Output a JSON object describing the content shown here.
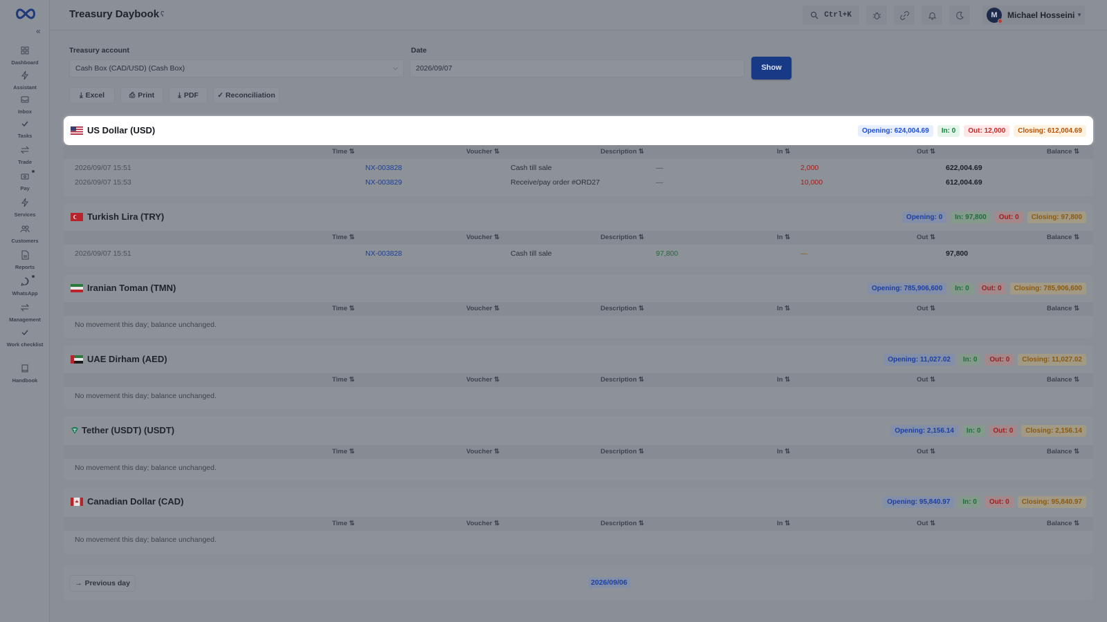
{
  "sidebar": {
    "items": [
      {
        "label": "Dashboard",
        "icon": "dashboard-icon"
      },
      {
        "label": "Assistant",
        "icon": "assistant-icon"
      },
      {
        "label": "Inbox",
        "icon": "inbox-icon"
      },
      {
        "label": "Tasks",
        "icon": "tasks-icon"
      },
      {
        "label": "Trade",
        "icon": "trade-icon"
      },
      {
        "label": "Pay",
        "icon": "pay-icon"
      },
      {
        "label": "Services",
        "icon": "services-icon"
      },
      {
        "label": "Customers",
        "icon": "customers-icon"
      },
      {
        "label": "Reports",
        "icon": "reports-icon"
      },
      {
        "label": "WhatsApp",
        "icon": "whatsapp-icon"
      },
      {
        "label": "Management",
        "icon": "management-icon"
      },
      {
        "label": "Work checklist",
        "icon": "checklist-icon"
      },
      {
        "label": "Handbook",
        "icon": "handbook-icon"
      }
    ]
  },
  "header": {
    "title": "Treasury Daybook",
    "search_shortcut": "Ctrl+K",
    "user": {
      "initial": "M",
      "name": "Michael Hosseini"
    }
  },
  "filters": {
    "account_label": "Treasury account",
    "account_value": "Cash Box (CAD/USD) (Cash Box)",
    "date_label": "Date",
    "date_value": "2026/09/07",
    "show_label": "Show"
  },
  "toolbar": {
    "excel": "Excel",
    "print": "Print",
    "pdf": "PDF",
    "reconciliation": "✓ Reconciliation"
  },
  "columns": {
    "time": "Time ⇅",
    "voucher": "Voucher ⇅",
    "description": "Description ⇅",
    "in": "In ⇅",
    "out": "Out ⇅",
    "balance": "Balance ⇅"
  },
  "sections": [
    {
      "title": "US Dollar (USD)",
      "opening": "Opening: 624,004.69",
      "in": "In: 0",
      "out": "Out: 12,000",
      "closing": "Closing: 612,004.69",
      "rows": [
        {
          "time": "2026/09/07 15:51",
          "voucher": "NX-003828",
          "description": "Cash till sale",
          "in": "—",
          "out": "2,000",
          "balance": "622,004.69"
        },
        {
          "time": "2026/09/07 15:53",
          "voucher": "NX-003829",
          "description": "Receive/pay order #ORD27",
          "in": "—",
          "out": "10,000",
          "balance": "612,004.69"
        }
      ]
    },
    {
      "title": "Turkish Lira (TRY)",
      "opening": "Opening: 0",
      "in": "In: 97,800",
      "out": "Out: 0",
      "closing": "Closing: 97,800",
      "rows": [
        {
          "time": "2026/09/07 15:51",
          "voucher": "NX-003828",
          "description": "Cash till sale",
          "in": "97,800",
          "out": "—",
          "balance": "97,800"
        }
      ]
    },
    {
      "title": "Iranian Toman (TMN)",
      "opening": "Opening: 785,906,600",
      "in": "In: 0",
      "out": "Out: 0",
      "closing": "Closing: 785,906,600",
      "empty": "No movement this day; balance unchanged."
    },
    {
      "title": "UAE Dirham (AED)",
      "opening": "Opening: 11,027.02",
      "in": "In: 0",
      "out": "Out: 0",
      "closing": "Closing: 11,027.02",
      "empty": "No movement this day; balance unchanged."
    },
    {
      "title": "Tether (USDT) (USDT)",
      "opening": "Opening: 2,156.14",
      "in": "In: 0",
      "out": "Out: 0",
      "closing": "Closing: 2,156.14",
      "empty": "No movement this day; balance unchanged."
    },
    {
      "title": "Canadian Dollar (CAD)",
      "opening": "Opening: 95,840.97",
      "in": "In: 0",
      "out": "Out: 0",
      "closing": "Closing: 95,840.97",
      "empty": "No movement this day; balance unchanged."
    }
  ],
  "footer": {
    "prev_label": "Previous day",
    "prev_date": "2026/09/06"
  },
  "colors": {
    "accent": "#183a86",
    "opening": "#1d4ed8",
    "in": "#15803d",
    "out": "#c62828",
    "closing": "#b45309"
  }
}
